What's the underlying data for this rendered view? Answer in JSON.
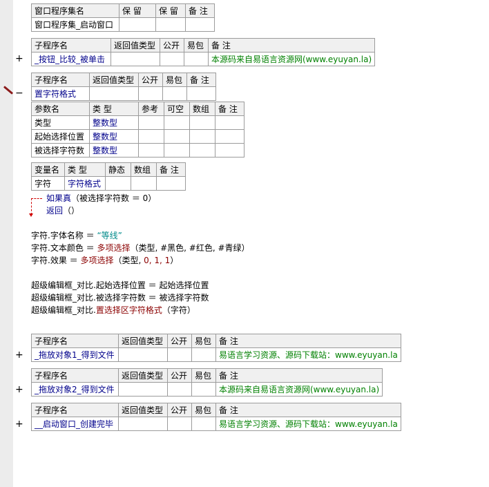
{
  "class_table": {
    "headers": [
      "窗口程序集名",
      "保 留",
      "保 留",
      "备 注"
    ],
    "row": [
      "窗口程序集_启动窗口",
      "",
      "",
      ""
    ]
  },
  "sub_header": [
    "子程序名",
    "返回值类型",
    "公开",
    "易包",
    "备 注"
  ],
  "sub1": {
    "marker": "+",
    "cells": [
      "_按钮_比较_被单击",
      "",
      "",
      "",
      "本源码来自易语言资源网(www.eyuyan.la)"
    ]
  },
  "sub2": {
    "marker": "−",
    "cells": [
      "置字符格式",
      "",
      "",
      "",
      ""
    ]
  },
  "param_header": [
    "参数名",
    "类 型",
    "参考",
    "可空",
    "数组",
    "备 注"
  ],
  "params": [
    [
      "类型",
      "整数型",
      "",
      "",
      "",
      ""
    ],
    [
      "起始选择位置",
      "整数型",
      "",
      "",
      "",
      ""
    ],
    [
      "被选择字符数",
      "整数型",
      "",
      "",
      "",
      ""
    ]
  ],
  "var_header": [
    "变量名",
    "类 型",
    "静态",
    "数组",
    "备 注"
  ],
  "var_row": [
    "字符",
    "字符格式",
    "",
    "",
    ""
  ],
  "code": {
    "if_kw": "如果真",
    "if_cond": "（被选择字符数 ＝ 0）",
    "ret_kw": "返回",
    "ret_args": "（）",
    "l1_a": "字符.字体名称 ＝ ",
    "l1_b": "“等线”",
    "l2_a": "字符.文本颜色 ＝ ",
    "l2_b": "多项选择",
    "l2_c": "（类型, #黑色, #红色, #青绿）",
    "l3_a": "字符.效果 ＝ ",
    "l3_b": "多项选择",
    "l3_c": "（类型, ",
    "l3_d": "0, 1, 1",
    "l3_e": "）",
    "l4": "超级编辑框_对比.起始选择位置 ＝ 起始选择位置",
    "l5": "超级编辑框_对比.被选择字符数 ＝ 被选择字符数",
    "l6_a": "超级编辑框_对比.",
    "l6_b": "置选择区字符格式",
    "l6_c": "（字符）"
  },
  "sub3": {
    "marker": "+",
    "cells": [
      "_拖放对象1_得到文件",
      "",
      "",
      "",
      "易语言学习资源、源码下载站：www.eyuyan.la"
    ]
  },
  "sub4": {
    "marker": "+",
    "cells": [
      "_拖放对象2_得到文件",
      "",
      "",
      "",
      "本源码来自易语言资源网(www.eyuyan.la)"
    ]
  },
  "sub5": {
    "marker": "+",
    "cells": [
      "__启动窗口_创建完毕",
      "",
      "",
      "",
      "易语言学习资源、源码下载站：www.eyuyan.la"
    ]
  }
}
